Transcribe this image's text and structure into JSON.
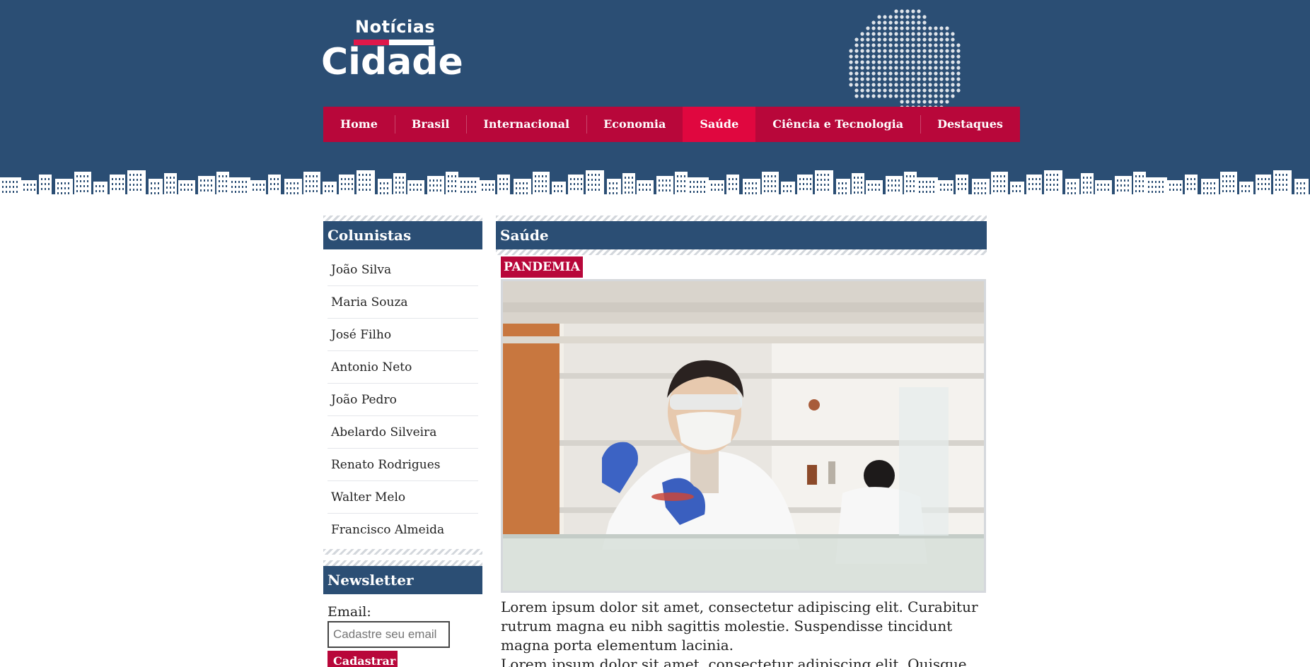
{
  "header": {
    "logo_top": "Notícias",
    "logo_main": "Cidade",
    "nav": [
      {
        "label": "Home"
      },
      {
        "label": "Brasil"
      },
      {
        "label": "Internacional"
      },
      {
        "label": "Economia"
      },
      {
        "label": "Saúde",
        "active": true
      },
      {
        "label": "Ciência e Tecnologia"
      },
      {
        "label": "Destaques"
      }
    ]
  },
  "sidebar": {
    "columnists_title": "Colunistas",
    "columnists": [
      "João Silva",
      "Maria Souza",
      "José Filho",
      "Antonio Neto",
      "João Pedro",
      "Abelardo Silveira",
      "Renato Rodrigues",
      "Walter Melo",
      "Francisco Almeida"
    ],
    "newsletter_title": "Newsletter",
    "email_label": "Email:",
    "email_placeholder": "Cadastre seu email",
    "submit_label": "Cadastrar"
  },
  "main": {
    "section_title": "Saúde",
    "tag": "PANDEMIA",
    "paragraphs": [
      "Lorem ipsum dolor sit amet, consectetur adipiscing elit. Curabitur rutrum magna eu nibh sagittis molestie. Suspendisse tincidunt magna porta elementum lacinia.",
      "Lorem ipsum dolor sit amet, consectetur adipiscing elit. Quisque vitae"
    ]
  },
  "colors": {
    "header_bg": "#2b4e74",
    "nav_bg": "#b8073a",
    "nav_active": "#e0073f"
  }
}
